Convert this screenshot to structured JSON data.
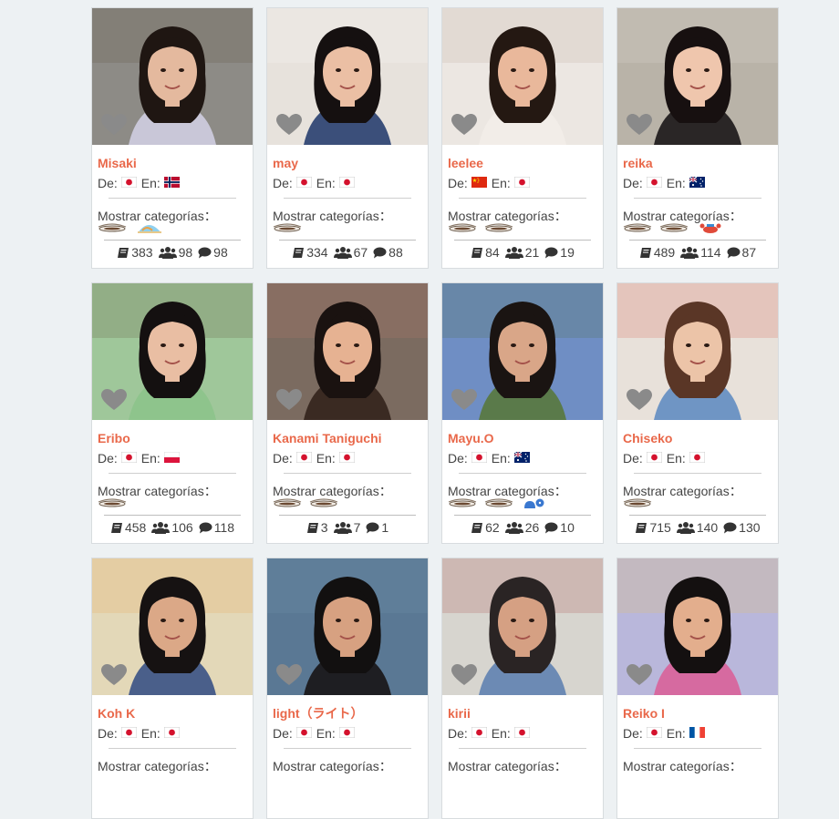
{
  "labels": {
    "from": "De:",
    "to": "En:",
    "categories": "Mostrar categorías："
  },
  "colors": {
    "name": "#e9684a",
    "background": "#edf1f3",
    "heart": "#8a8a8a"
  },
  "icons": {
    "favorite": "heart-icon",
    "lessons": "book-icon",
    "students": "users-icon",
    "reviews": "comment-icon"
  },
  "tutors": [
    {
      "name": "Misaki",
      "from": "jp",
      "to": "no",
      "categories": [
        "coffee",
        "beach"
      ],
      "lessons": "383",
      "students": "98",
      "reviews": "98",
      "photo": {
        "bg": "#8d8b86",
        "skin": "#e4b99e",
        "hair": "#1f1612",
        "shirt": "#c9c7d8",
        "accent": "#5a4a3a"
      }
    },
    {
      "name": "may",
      "from": "jp",
      "to": "jp",
      "categories": [
        "coffee"
      ],
      "lessons": "334",
      "students": "67",
      "reviews": "88",
      "photo": {
        "bg": "#e7e2dc",
        "skin": "#ebbfa4",
        "hair": "#151010",
        "shirt": "#3b4f7a",
        "accent": "#ffffff"
      }
    },
    {
      "name": "leelee",
      "from": "cn",
      "to": "jp",
      "categories": [
        "coffee",
        "coffee"
      ],
      "lessons": "84",
      "students": "21",
      "reviews": "19",
      "photo": {
        "bg": "#ece7e2",
        "skin": "#e9b89b",
        "hair": "#241812",
        "shirt": "#f2ede8",
        "accent": "#b7a08f"
      }
    },
    {
      "name": "reika",
      "from": "jp",
      "to": "au",
      "categories": [
        "coffee",
        "coffee",
        "crab"
      ],
      "lessons": "489",
      "students": "114",
      "reviews": "87",
      "photo": {
        "bg": "#b9b3a8",
        "skin": "#efc6ad",
        "hair": "#171010",
        "shirt": "#2a2626",
        "accent": "#e9e4dc"
      }
    },
    {
      "name": "Eribo",
      "from": "jp",
      "to": "pl",
      "categories": [
        "coffee"
      ],
      "lessons": "458",
      "students": "106",
      "reviews": "118",
      "photo": {
        "bg": "#9fc79a",
        "skin": "#e9bea3",
        "hair": "#141010",
        "shirt": "#8ec48c",
        "accent": "#5a3b2f"
      }
    },
    {
      "name": "Kanami Taniguchi",
      "from": "jp",
      "to": "jp",
      "categories": [
        "coffee",
        "coffee"
      ],
      "lessons": "3",
      "students": "7",
      "reviews": "1",
      "photo": {
        "bg": "#7b6b60",
        "skin": "#e6b292",
        "hair": "#1a1210",
        "shirt": "#3a2a22",
        "accent": "#c9806e"
      }
    },
    {
      "name": "Mayu.O",
      "from": "jp",
      "to": "au",
      "categories": [
        "coffee",
        "coffee",
        "chat"
      ],
      "lessons": "62",
      "students": "26",
      "reviews": "10",
      "photo": {
        "bg": "#6f8ec4",
        "skin": "#d9a688",
        "hair": "#1a1412",
        "shirt": "#5a7a4a",
        "accent": "#4a6a2a"
      }
    },
    {
      "name": "Chiseko",
      "from": "jp",
      "to": "jp",
      "categories": [
        "coffee"
      ],
      "lessons": "715",
      "students": "140",
      "reviews": "130",
      "photo": {
        "bg": "#e8e1da",
        "skin": "#ecc4a8",
        "hair": "#5a3626",
        "shirt": "#6f95c4",
        "accent": "#d34a3a"
      }
    },
    {
      "name": "Koh K",
      "from": "jp",
      "to": "jp",
      "categories": [],
      "lessons": "",
      "students": "",
      "reviews": "",
      "photo": {
        "bg": "#e3d8b8",
        "skin": "#dba887",
        "hair": "#161212",
        "shirt": "#4a5f8a",
        "accent": "#e79a4a"
      }
    },
    {
      "name": "light（ライト）",
      "from": "jp",
      "to": "jp",
      "categories": [],
      "lessons": "",
      "students": "",
      "reviews": "",
      "photo": {
        "bg": "#5a7894",
        "skin": "#d7a181",
        "hair": "#121010",
        "shirt": "#1e1e22",
        "accent": "#7a9ab4"
      }
    },
    {
      "name": "kirii",
      "from": "jp",
      "to": "jp",
      "categories": [],
      "lessons": "",
      "students": "",
      "reviews": "",
      "photo": {
        "bg": "#d7d5cf",
        "skin": "#d5a083",
        "hair": "#2a2424",
        "shirt": "#6c8ab4",
        "accent": "#a33a3a"
      }
    },
    {
      "name": "Reiko I",
      "from": "jp",
      "to": "fr",
      "categories": [],
      "lessons": "",
      "students": "",
      "reviews": "",
      "photo": {
        "bg": "#b9b7db",
        "skin": "#e3ae8d",
        "hair": "#141010",
        "shirt": "#d66aa0",
        "accent": "#f2c24a"
      }
    }
  ]
}
